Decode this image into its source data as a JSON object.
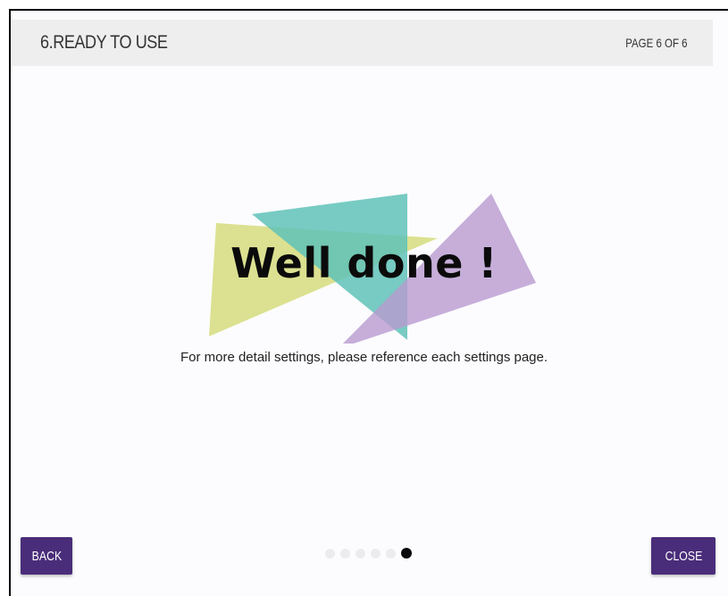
{
  "header": {
    "title": "6.READY TO USE",
    "page_indicator": "PAGE 6 OF 6"
  },
  "main": {
    "headline": "Well done !",
    "description": "For more detail settings, please reference each settings page."
  },
  "pagination": {
    "total": 6,
    "current": 6
  },
  "buttons": {
    "back_label": "BACK",
    "close_label": "CLOSE"
  },
  "colors": {
    "button": "#4a2d7a",
    "header_bg": "#eeeeee",
    "triangle_yellow": "#d5dc7c",
    "triangle_teal": "#5fc2b8",
    "triangle_purple": "#b89ad0",
    "dot_active": "#0a0a0a",
    "dot_inactive": "#ececef"
  }
}
